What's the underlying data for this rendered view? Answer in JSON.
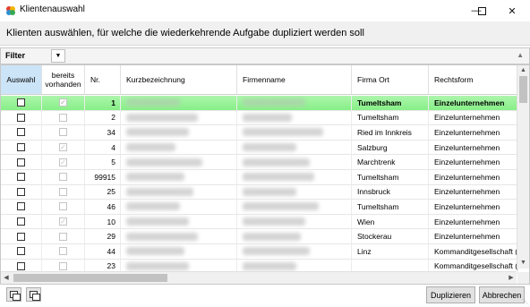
{
  "window": {
    "title": "Klientenauswahl",
    "minimize_icon": "minimize-icon",
    "maximize_icon": "maximize-icon",
    "close_icon": "close-icon"
  },
  "heading": "Klienten auswählen, für welche die wiederkehrende Aufgabe dupliziert werden soll",
  "filter": {
    "label": "Filter"
  },
  "table": {
    "columns": [
      {
        "key": "auswahl",
        "label": "Auswahl"
      },
      {
        "key": "vorhanden",
        "label": "bereits vorhanden"
      },
      {
        "key": "nr",
        "label": "Nr."
      },
      {
        "key": "kurz",
        "label": "Kurzbezeichnung"
      },
      {
        "key": "firma",
        "label": "Firmenname"
      },
      {
        "key": "ort",
        "label": "Firma Ort"
      },
      {
        "key": "rechtsform",
        "label": "Rechtsform"
      }
    ],
    "rows": [
      {
        "selected": false,
        "vorhanden": true,
        "nr": "1",
        "ort": "Tumeltsham",
        "rechtsform": "Einzelunternehmen"
      },
      {
        "selected": false,
        "vorhanden": false,
        "nr": "2",
        "ort": "Tumeltsham",
        "rechtsform": "Einzelunternehmen"
      },
      {
        "selected": false,
        "vorhanden": false,
        "nr": "34",
        "ort": "Ried im Innkreis",
        "rechtsform": "Einzelunternehmen"
      },
      {
        "selected": false,
        "vorhanden": true,
        "nr": "4",
        "ort": "Salzburg",
        "rechtsform": "Einzelunternehmen"
      },
      {
        "selected": false,
        "vorhanden": true,
        "nr": "5",
        "ort": "Marchtrenk",
        "rechtsform": "Einzelunternehmen"
      },
      {
        "selected": false,
        "vorhanden": false,
        "nr": "99915",
        "ort": "Tumeltsham",
        "rechtsform": "Einzelunternehmen"
      },
      {
        "selected": false,
        "vorhanden": false,
        "nr": "25",
        "ort": "Innsbruck",
        "rechtsform": "Einzelunternehmen"
      },
      {
        "selected": false,
        "vorhanden": false,
        "nr": "46",
        "ort": "Tumeltsham",
        "rechtsform": "Einzelunternehmen"
      },
      {
        "selected": false,
        "vorhanden": true,
        "nr": "10",
        "ort": "Wien",
        "rechtsform": "Einzelunternehmen"
      },
      {
        "selected": false,
        "vorhanden": false,
        "nr": "29",
        "ort": "Stockerau",
        "rechtsform": "Einzelunternehmen"
      },
      {
        "selected": false,
        "vorhanden": false,
        "nr": "44",
        "ort": "Linz",
        "rechtsform": "Kommanditgesellschaft (..."
      },
      {
        "selected": false,
        "vorhanden": false,
        "nr": "23",
        "ort": "",
        "rechtsform": "Kommanditgesellschaft (..."
      }
    ]
  },
  "buttons": {
    "select_all_icon": "select-all-icon",
    "deselect_all_icon": "deselect-all-icon",
    "duplicate": "Duplizieren",
    "cancel": "Abbrechen"
  },
  "colors": {
    "highlight_row": "#8ff08f",
    "selected_header": "#cce4f7"
  }
}
